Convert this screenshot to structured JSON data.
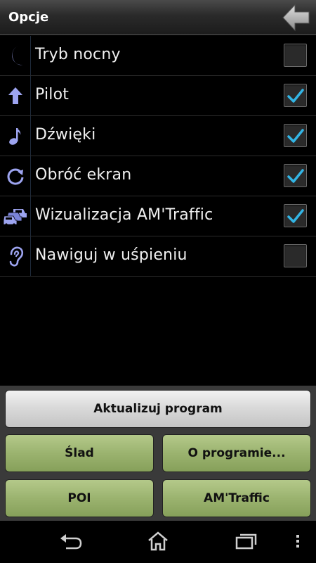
{
  "header": {
    "title": "Opcje",
    "back_icon": "back-arrow-icon"
  },
  "options": [
    {
      "label": "Tryb nocny",
      "icon": "moon-icon",
      "checked": false
    },
    {
      "label": "Pilot",
      "icon": "arrow-up-icon",
      "checked": true
    },
    {
      "label": "Dźwięki",
      "icon": "music-note-icon",
      "checked": true
    },
    {
      "label": "Obróć ekran",
      "icon": "rotate-icon",
      "checked": true
    },
    {
      "label": "Wizualizacja AM'Traffic",
      "icon": "traffic-cars-icon",
      "checked": true
    },
    {
      "label": "Nawiguj w uśpieniu",
      "icon": "ear-icon",
      "checked": false
    }
  ],
  "buttons": {
    "update": "Aktualizuj program",
    "track": "Ślad",
    "about": "O programie...",
    "poi": "POI",
    "amtraffic": "AM'Traffic"
  },
  "navbar": {
    "back": "nav-back-icon",
    "home": "nav-home-icon",
    "recents": "nav-recents-icon",
    "menu": "nav-menu-icon"
  },
  "colors": {
    "icon": "#9da4f0",
    "check": "#33b5e5",
    "green_button": "#9bb36f",
    "gray_button": "#d8d8d8"
  }
}
